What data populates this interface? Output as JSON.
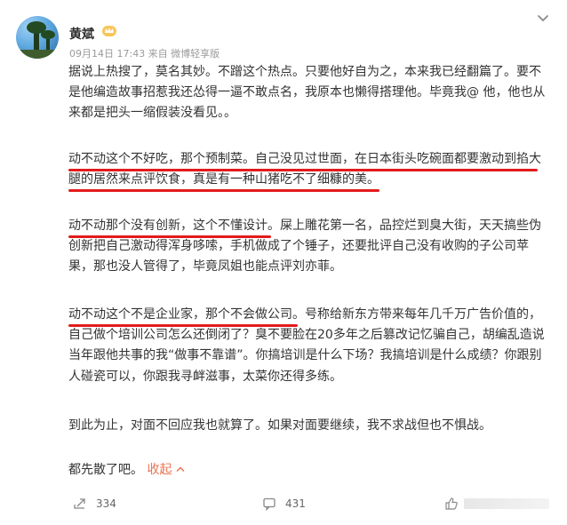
{
  "author": {
    "name": "黄斌",
    "meta": "09月14日 17:43  来自 微博轻享版"
  },
  "post": {
    "p1": [
      "据说上热搜了，莫名其妙。不蹭这个热点。只要他好自为之，本来我已经翻篇了。要不",
      "是他编造故事招惹我还怂得一逼不敢点名，我原本也懒得搭理他。毕竟我@ 他，他也从",
      "来都是把头一缩假装没看见。。"
    ],
    "p2": [
      "动不动这个不好吃，那个预制菜。自己没见过世面，在日本街头吃碗面都要激动到掐大",
      "腿的居然来点评饮食，真是有一种山猪吃不了细糠的美。"
    ],
    "p3": [
      "动不动那个没有创新，这个不懂设计。屎上雕花第一名，品控烂到臭大街，天天搞些伪",
      "创新把自己激动得浑身哆嗦，手机做成了个锤子，还要批评自己没有收购的子公司苹",
      "果，那也没人管得了，毕竟凤姐也能点评刘亦菲。"
    ],
    "p4": [
      "动不动这个不是企业家，那个不会做公司。号称给新东方带来每年几千万广告价值的，",
      "自己做个培训公司怎么还倒闭了？臭不要脸在20多年之后篡改记忆骗自己，胡编乱造说",
      "当年跟他共事的我“做事不靠谱”。你搞培训是什么下场？我搞培训是什么成绩？你跟别",
      "人碰瓷可以，你跟我寻衅滋事，太菜你还得多练。"
    ],
    "p5": [
      "到此为止，对面不回应我也就算了。如果对面要继续，我不求战但也不惧战。"
    ],
    "p6": "都先散了吧。",
    "collapse_label": "收起"
  },
  "footer": {
    "repost_count": "334",
    "comment_count": "431"
  },
  "icons": {
    "badge": "crown-badge-icon",
    "chevron": "chevron-down-icon",
    "repost": "repost-icon",
    "comment": "comment-icon",
    "like": "like-icon"
  },
  "colors": {
    "highlight_underline": "#e31b1b",
    "link": "#eb7350",
    "meta": "#9a9a9a"
  }
}
